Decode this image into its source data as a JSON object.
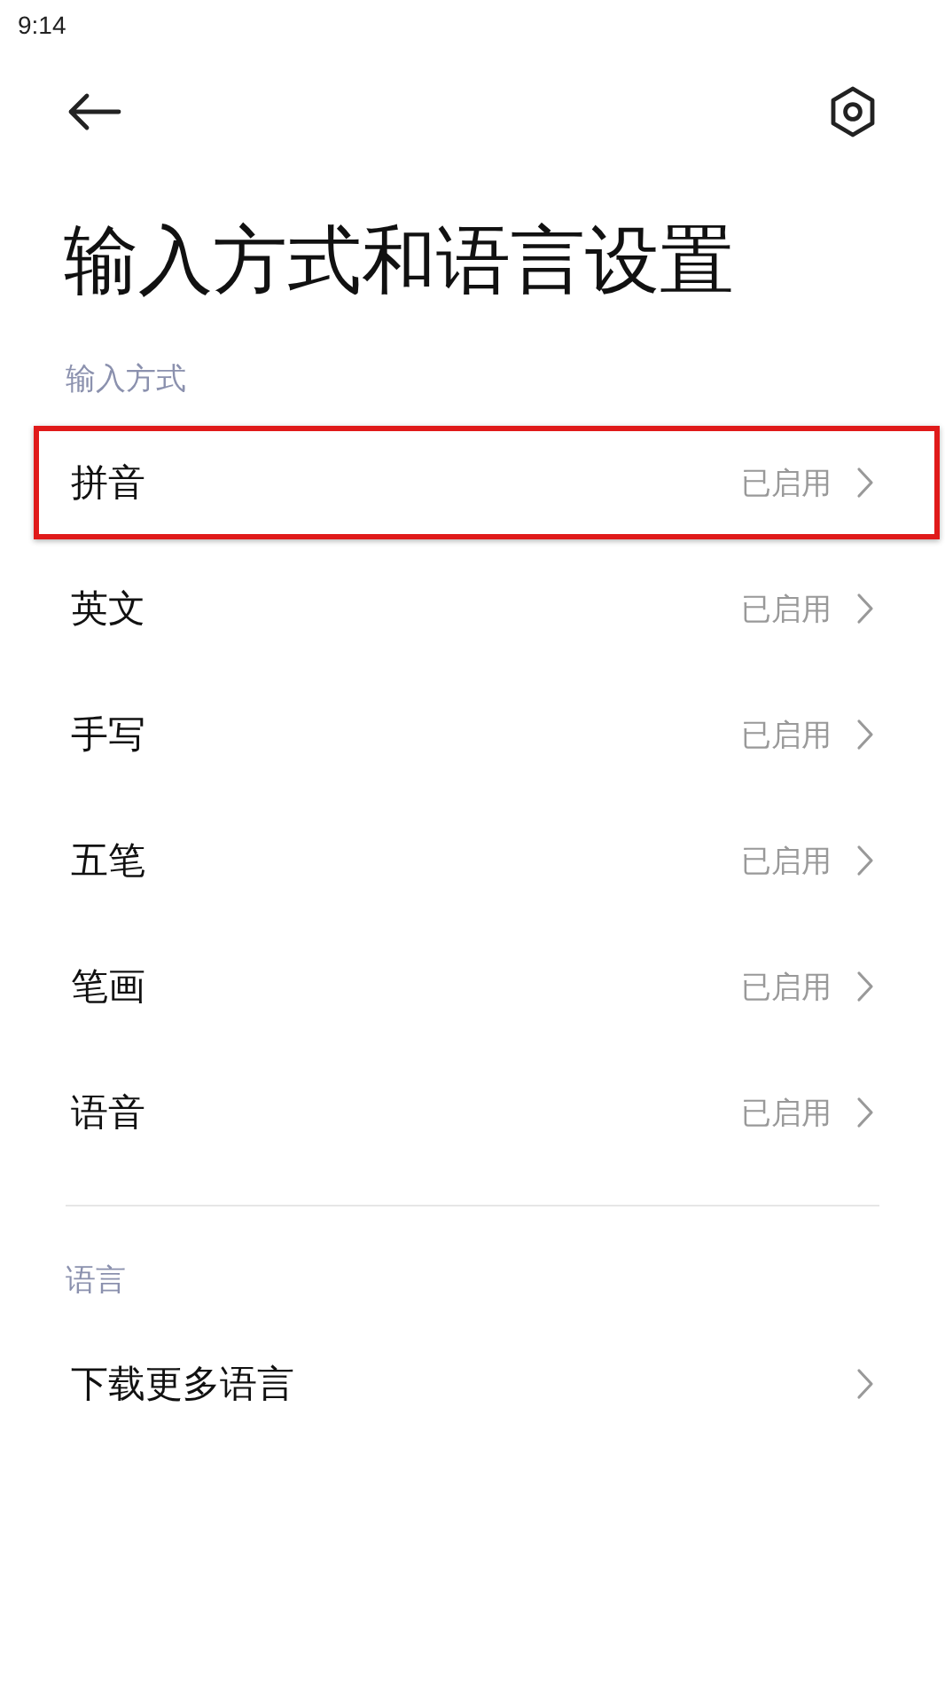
{
  "status_bar": {
    "time": "9:14"
  },
  "title": "输入方式和语言设置",
  "sections": [
    {
      "header": "输入方式",
      "items": [
        {
          "label": "拼音",
          "status": "已启用",
          "highlighted": true
        },
        {
          "label": "英文",
          "status": "已启用",
          "highlighted": false
        },
        {
          "label": "手写",
          "status": "已启用",
          "highlighted": false
        },
        {
          "label": "五笔",
          "status": "已启用",
          "highlighted": false
        },
        {
          "label": "笔画",
          "status": "已启用",
          "highlighted": false
        },
        {
          "label": "语音",
          "status": "已启用",
          "highlighted": false
        }
      ]
    },
    {
      "header": "语言",
      "items": [
        {
          "label": "下载更多语言",
          "highlighted": false
        }
      ]
    }
  ]
}
